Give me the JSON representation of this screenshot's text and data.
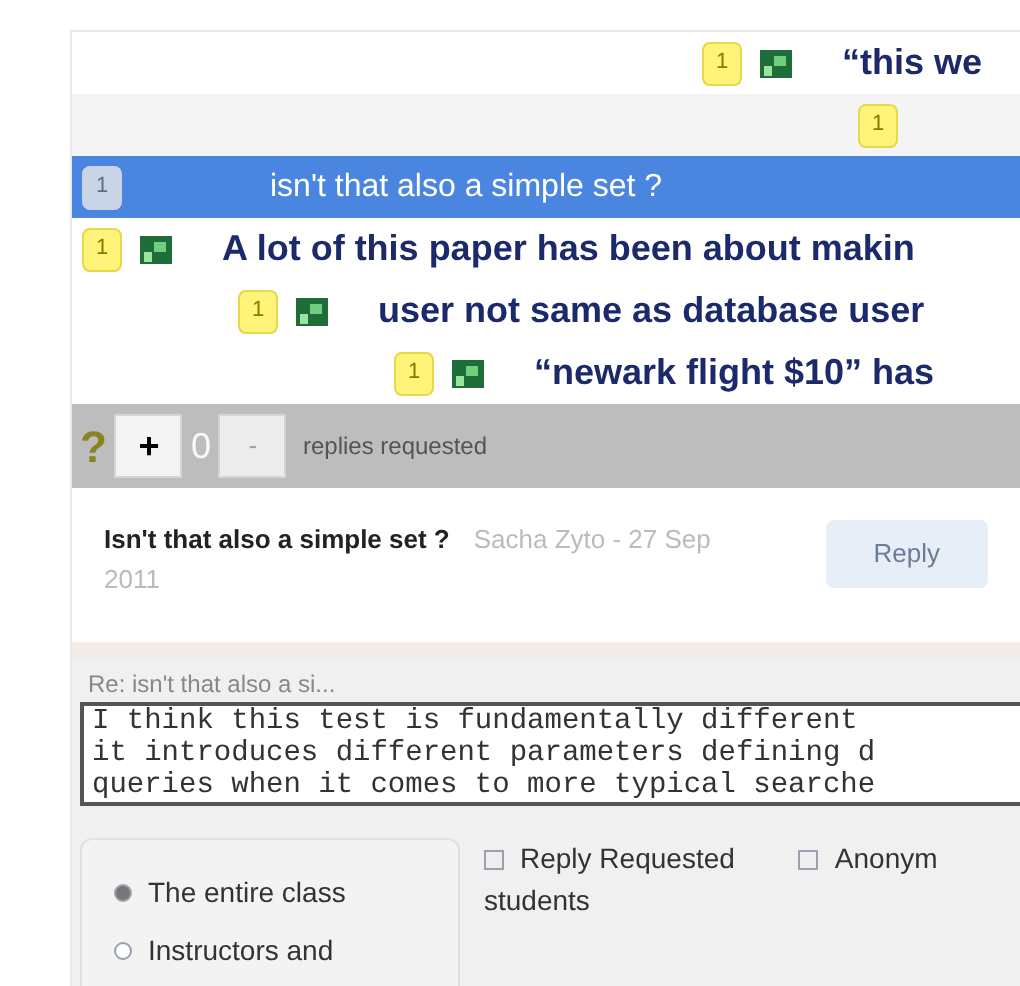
{
  "thread": [
    {
      "count": "1",
      "has_icon": true,
      "text": "“this we",
      "selected": false,
      "children": [
        {
          "count": "1",
          "has_icon": false,
          "selected": false
        }
      ]
    },
    {
      "count": "1",
      "has_icon": false,
      "text": "isn't that also a simple set ?",
      "selected": true
    },
    {
      "count": "1",
      "has_icon": true,
      "text": "A lot of this paper has been about makin",
      "selected": false,
      "children": [
        {
          "count": "1",
          "has_icon": true,
          "text": "user not same as database user",
          "selected": false,
          "children": [
            {
              "count": "1",
              "has_icon": true,
              "text": "“newark flight $10” has",
              "selected": false
            }
          ]
        }
      ]
    }
  ],
  "toolbar": {
    "help": "?",
    "plus": "+",
    "count": "0",
    "minus": "-",
    "label": "replies requested"
  },
  "comment": {
    "title": "Isn't that also a simple set ?",
    "meta": "Sacha Zyto - 27 Sep 2011",
    "reply": "Reply"
  },
  "reply_form": {
    "heading": "Re: isn't that also a si...",
    "value": "I think this test is fundamentally different\nit introduces different parameters defining d\nqueries when it comes to more typical searche",
    "audience": [
      {
        "label": "The entire class",
        "selected": true
      },
      {
        "label": "Instructors and",
        "selected": false
      }
    ],
    "options": [
      {
        "label": "Reply Requested",
        "checked": false
      },
      {
        "label": "Anonym",
        "checked": false
      }
    ],
    "note": "students"
  }
}
